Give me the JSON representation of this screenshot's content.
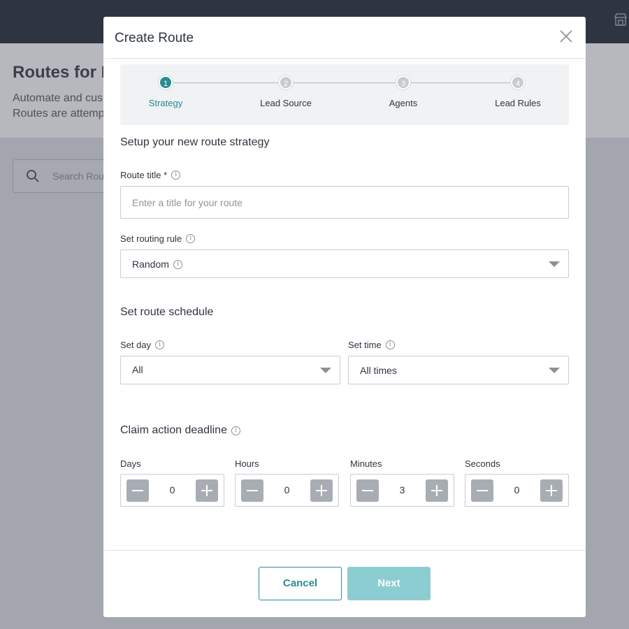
{
  "background": {
    "title": "Routes for M",
    "description_lines": [
      "Automate and cus",
      "Routes are attemp"
    ],
    "search_placeholder": "Search Rou"
  },
  "modal": {
    "title": "Create Route",
    "steps": [
      {
        "number": "1",
        "label": "Strategy",
        "active": true
      },
      {
        "number": "2",
        "label": "Lead Source",
        "active": false
      },
      {
        "number": "3",
        "label": "Agents",
        "active": false
      },
      {
        "number": "4",
        "label": "Lead Rules",
        "active": false
      }
    ],
    "strategy_heading": "Setup your new route strategy",
    "route_title": {
      "label": "Route title *",
      "placeholder": "Enter a title for your route",
      "value": ""
    },
    "routing_rule": {
      "label": "Set routing rule",
      "value": "Random"
    },
    "schedule_heading": "Set route schedule",
    "set_day": {
      "label": "Set day",
      "value": "All"
    },
    "set_time": {
      "label": "Set time",
      "value": "All times"
    },
    "deadline_heading": "Claim action deadline",
    "deadline": [
      {
        "label": "Days",
        "value": "0"
      },
      {
        "label": "Hours",
        "value": "0"
      },
      {
        "label": "Minutes",
        "value": "3"
      },
      {
        "label": "Seconds",
        "value": "0"
      }
    ],
    "cancel_label": "Cancel",
    "next_label": "Next"
  },
  "colors": {
    "accent": "#2a8c95",
    "next_disabled": "#8ccdd2",
    "topbar": "#2f3441"
  }
}
